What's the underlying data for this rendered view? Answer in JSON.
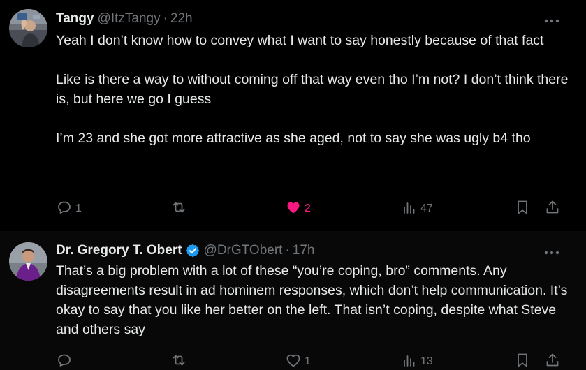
{
  "tweets": [
    {
      "display_name": "Tangy",
      "handle": "@ItzTangy",
      "separator": "·",
      "time": "22h",
      "paragraphs": [
        "Yeah I don’t know how to convey what I want to say honestly because of that fact",
        "Like is there a way to without coming off that way even tho I’m not? I don’t think there is, but here we go I guess",
        "I’m 23 and she got more attractive as she aged, not to say she was ugly b4 tho"
      ],
      "actions": {
        "replies": "1",
        "reposts": "",
        "likes": "2",
        "views": "47"
      },
      "liked": true,
      "verified": false
    },
    {
      "display_name": "Dr. Gregory T. Obert",
      "handle": "@DrGTObert",
      "separator": "·",
      "time": "17h",
      "paragraphs": [
        "That’s a big problem with a lot of these “you’re coping, bro” comments. Any disagreements result in ad hominem responses, which don’t help communication. It’s okay to say that you like her better on the left. That isn’t coping, despite what Steve and others say"
      ],
      "actions": {
        "replies": "",
        "reposts": "",
        "likes": "1",
        "views": "13"
      },
      "liked": false,
      "verified": true
    }
  ],
  "colors": {
    "background": "#000000",
    "text_primary": "#e7e9ea",
    "text_secondary": "#71767b",
    "like_active": "#f91880",
    "verified_badge": "#1d9bf0",
    "thread_line": "#333639"
  },
  "icons": {
    "reply": "reply-icon",
    "repost": "repost-icon",
    "like": "heart-icon",
    "views": "views-icon",
    "bookmark": "bookmark-icon",
    "share": "share-icon",
    "more": "more-options-icon",
    "verified": "verified-badge-icon"
  }
}
